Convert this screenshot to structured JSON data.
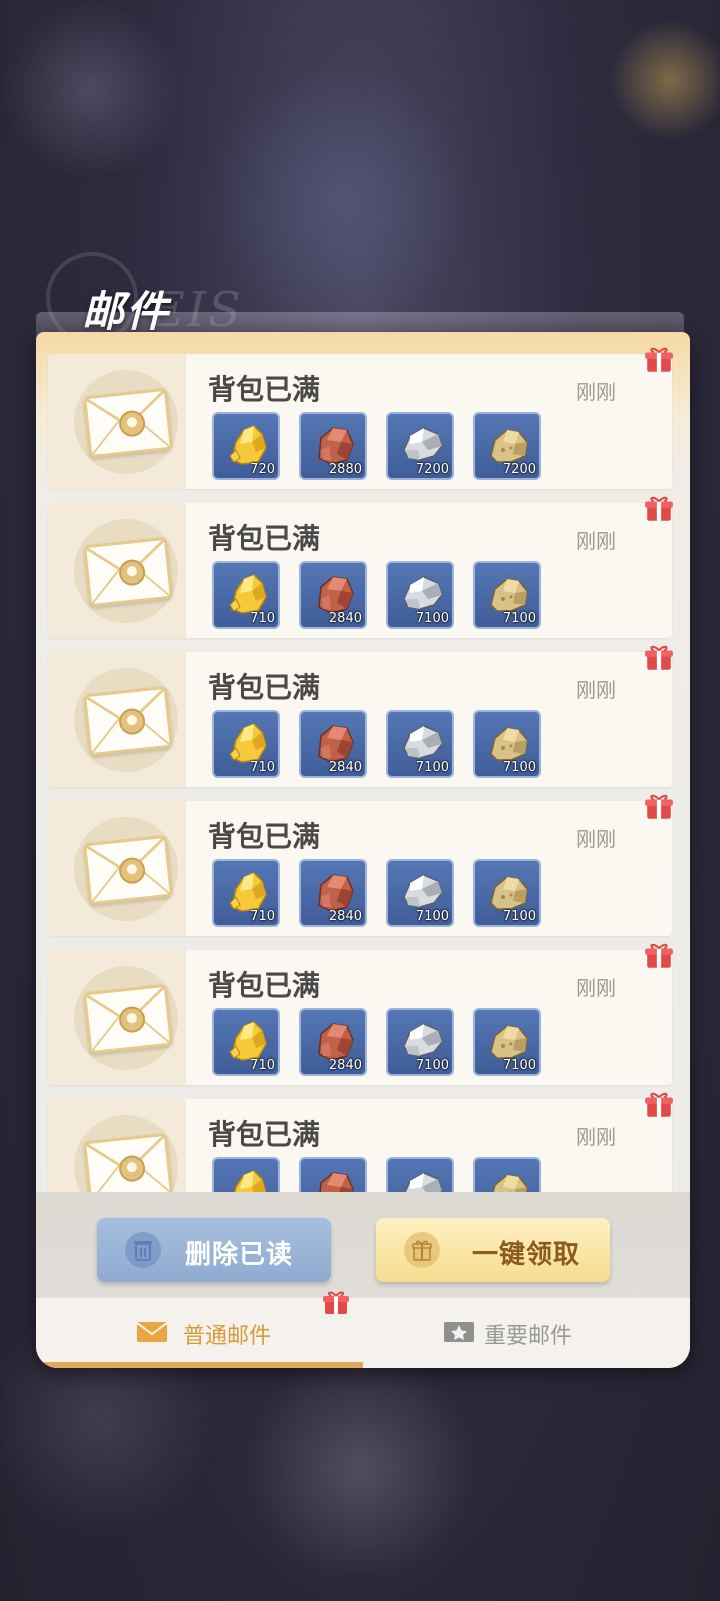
{
  "panel": {
    "title": "邮件",
    "watermark": "EIS"
  },
  "mails": [
    {
      "title": "背包已满",
      "time": "刚刚",
      "items": [
        {
          "type": "gold-ore",
          "count": "720"
        },
        {
          "type": "copper-ore",
          "count": "2880"
        },
        {
          "type": "silver-ore",
          "count": "7200"
        },
        {
          "type": "sand-ore",
          "count": "7200"
        }
      ]
    },
    {
      "title": "背包已满",
      "time": "刚刚",
      "items": [
        {
          "type": "gold-ore",
          "count": "710"
        },
        {
          "type": "copper-ore",
          "count": "2840"
        },
        {
          "type": "silver-ore",
          "count": "7100"
        },
        {
          "type": "sand-ore",
          "count": "7100"
        }
      ]
    },
    {
      "title": "背包已满",
      "time": "刚刚",
      "items": [
        {
          "type": "gold-ore",
          "count": "710"
        },
        {
          "type": "copper-ore",
          "count": "2840"
        },
        {
          "type": "silver-ore",
          "count": "7100"
        },
        {
          "type": "sand-ore",
          "count": "7100"
        }
      ]
    },
    {
      "title": "背包已满",
      "time": "刚刚",
      "items": [
        {
          "type": "gold-ore",
          "count": "710"
        },
        {
          "type": "copper-ore",
          "count": "2840"
        },
        {
          "type": "silver-ore",
          "count": "7100"
        },
        {
          "type": "sand-ore",
          "count": "7100"
        }
      ]
    },
    {
      "title": "背包已满",
      "time": "刚刚",
      "items": [
        {
          "type": "gold-ore",
          "count": "710"
        },
        {
          "type": "copper-ore",
          "count": "2840"
        },
        {
          "type": "silver-ore",
          "count": "7100"
        },
        {
          "type": "sand-ore",
          "count": "7100"
        }
      ]
    },
    {
      "title": "背包已满",
      "time": "刚刚",
      "items": [
        {
          "type": "gold-ore",
          "count": ""
        },
        {
          "type": "copper-ore",
          "count": ""
        },
        {
          "type": "silver-ore",
          "count": ""
        },
        {
          "type": "sand-ore",
          "count": ""
        }
      ]
    }
  ],
  "actions": {
    "delete_read_label": "删除已读",
    "claim_all_label": "一键领取"
  },
  "tabs": {
    "normal_label": "普通邮件",
    "important_label": "重要邮件",
    "active": "normal"
  },
  "colors": {
    "accent": "#e2a95a",
    "gift_red": "#e24a4a",
    "item_bg": "#4a6aa8"
  }
}
